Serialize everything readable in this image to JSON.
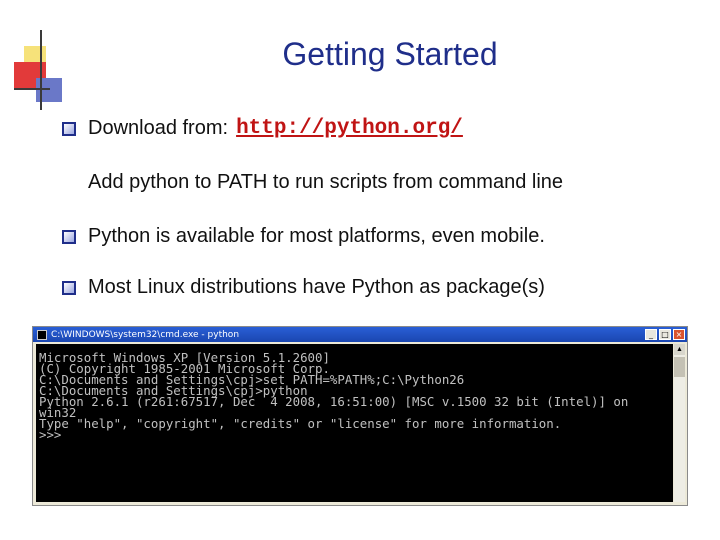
{
  "slide": {
    "title": "Getting Started",
    "bullets": [
      {
        "text": "Download from:",
        "url": "http://python.org/"
      },
      {
        "text": "Python is available for most platforms, even mobile."
      },
      {
        "text": "Most Linux distributions have Python as package(s)"
      }
    ],
    "subline": "Add python to PATH to run scripts from command line"
  },
  "console": {
    "title": "C:\\WINDOWS\\system32\\cmd.exe - python",
    "lines": [
      "Microsoft Windows XP [Version 5.1.2600]",
      "(C) Copyright 1985-2001 Microsoft Corp.",
      "",
      "C:\\Documents and Settings\\cpj>set PATH=%PATH%;C:\\Python26",
      "",
      "C:\\Documents and Settings\\cpj>python",
      "Python 2.6.1 (r261:67517, Dec  4 2008, 16:51:00) [MSC v.1500 32 bit (Intel)] on",
      "win32",
      "Type \"help\", \"copyright\", \"credits\" or \"license\" for more information.",
      ">>>"
    ]
  },
  "colors": {
    "title": "#1f2e8a",
    "url": "#c01414",
    "console_bg": "#000000",
    "console_text": "#c0c0c0"
  }
}
